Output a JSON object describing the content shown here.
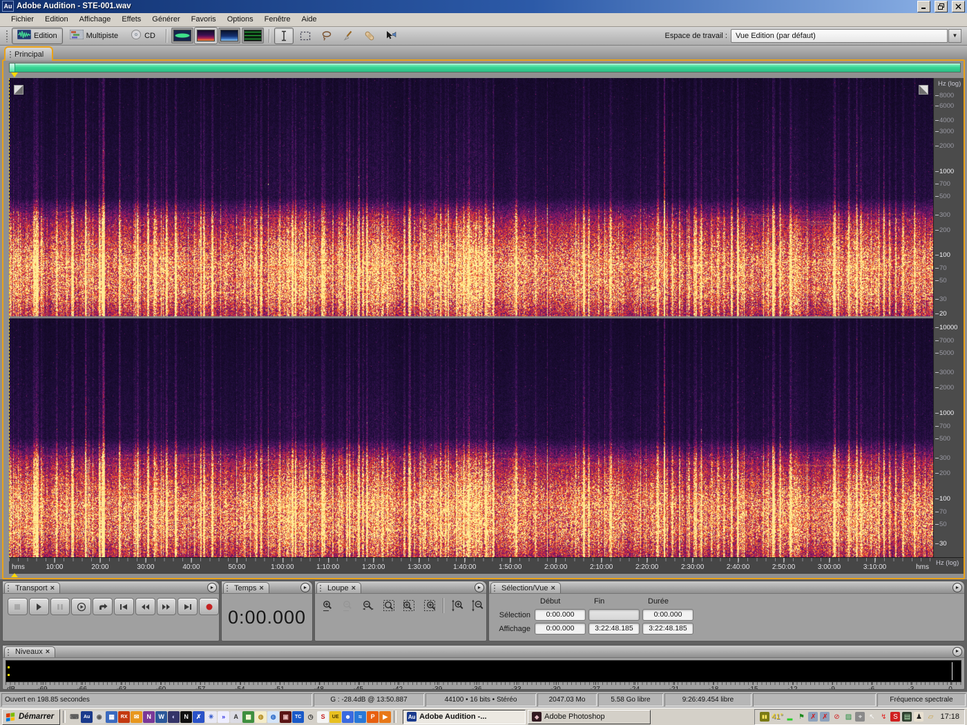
{
  "window": {
    "title": "Adobe Audition - STE-001.wav",
    "app_badge": "Au"
  },
  "icons": {
    "close": "×",
    "panel_menu": "►",
    "dropdown": "▼"
  },
  "menu": {
    "items": [
      "Fichier",
      "Edition",
      "Affichage",
      "Effets",
      "Générer",
      "Favoris",
      "Options",
      "Fenêtre",
      "Aide"
    ]
  },
  "toolbar": {
    "modes": [
      {
        "id": "edition",
        "label": "Edition",
        "active": true
      },
      {
        "id": "multipiste",
        "label": "Multipiste",
        "active": false
      },
      {
        "id": "cd",
        "label": "CD",
        "active": false
      }
    ],
    "views": [
      {
        "id": "waveform-view",
        "active": false
      },
      {
        "id": "spectral-frequency-view",
        "active": true
      },
      {
        "id": "spectral-pan-view",
        "active": false
      },
      {
        "id": "spectral-phase-view",
        "active": false
      }
    ],
    "tools": [
      {
        "id": "time-selection-tool",
        "active": true
      },
      {
        "id": "marquee-selection-tool",
        "active": false
      },
      {
        "id": "lasso-selection-tool",
        "active": false
      },
      {
        "id": "effects-paintbrush-tool",
        "active": false
      },
      {
        "id": "spot-healing-brush-tool",
        "active": false
      },
      {
        "id": "scrub-tool",
        "active": false
      }
    ],
    "workspace": {
      "label": "Espace de travail :",
      "value": "Vue Edition (par défaut)"
    }
  },
  "tabs": {
    "main": "Principal"
  },
  "spectral_view": {
    "unit_label": "Hz (log)",
    "palette": {
      "background": "#140a28",
      "mid": "#8a1858",
      "hot": "#f09040",
      "peak": "#ffec96"
    },
    "channels": [
      {
        "name": "left",
        "fmin": 19,
        "fmax": 13000,
        "labels": [
          {
            "f": 8000
          },
          {
            "f": 6000
          },
          {
            "f": 4000
          },
          {
            "f": 3000
          },
          {
            "f": 2000
          },
          {
            "f": 1000,
            "major": true
          },
          {
            "f": 700
          },
          {
            "f": 500
          },
          {
            "f": 300
          },
          {
            "f": 200
          },
          {
            "f": 100,
            "major": true
          },
          {
            "f": 70
          },
          {
            "f": 50
          },
          {
            "f": 30
          },
          {
            "f": 20,
            "major": true
          }
        ]
      },
      {
        "name": "right",
        "fmin": 21,
        "fmax": 13000,
        "labels": [
          {
            "f": 10000,
            "major": true
          },
          {
            "f": 7000
          },
          {
            "f": 5000
          },
          {
            "f": 3000
          },
          {
            "f": 2000
          },
          {
            "f": 1000,
            "major": true
          },
          {
            "f": 700
          },
          {
            "f": 500
          },
          {
            "f": 300
          },
          {
            "f": 200
          },
          {
            "f": 100,
            "major": true
          },
          {
            "f": 70
          },
          {
            "f": 50
          },
          {
            "f": 30,
            "major": true
          }
        ]
      }
    ]
  },
  "timeline": {
    "unit": "hms",
    "view_end_seconds": 12168.185,
    "labels": [
      "10:00",
      "20:00",
      "30:00",
      "40:00",
      "50:00",
      "1:00:00",
      "1:10:00",
      "1:20:00",
      "1:30:00",
      "1:40:00",
      "1:50:00",
      "2:00:00",
      "2:10:00",
      "2:20:00",
      "2:30:00",
      "2:40:00",
      "2:50:00",
      "3:00:00",
      "3:10:00"
    ]
  },
  "transport": {
    "title": "Transport",
    "buttons": [
      {
        "id": "stop",
        "disabled": true
      },
      {
        "id": "play",
        "disabled": false
      },
      {
        "id": "pause",
        "disabled": true
      },
      {
        "id": "play-from-cursor",
        "disabled": false
      },
      {
        "id": "play-looped",
        "disabled": false
      },
      {
        "id": "go-to-start",
        "disabled": false
      },
      {
        "id": "rewind",
        "disabled": false
      },
      {
        "id": "fast-forward",
        "disabled": false
      },
      {
        "id": "go-to-end",
        "disabled": false
      },
      {
        "id": "record",
        "disabled": false
      }
    ]
  },
  "temps": {
    "title": "Temps",
    "value": "0:00.000"
  },
  "loupe": {
    "title": "Loupe",
    "buttons": [
      {
        "id": "zoom-in-horizontal",
        "disabled": false
      },
      {
        "id": "zoom-out-horizontal",
        "disabled": true
      },
      {
        "id": "zoom-out-full",
        "disabled": false
      },
      {
        "id": "zoom-to-selection",
        "disabled": false
      },
      {
        "id": "zoom-selection-left",
        "disabled": false
      },
      {
        "id": "zoom-selection-right",
        "disabled": false
      },
      {
        "id": "zoom-in-vertical",
        "disabled": false
      },
      {
        "id": "zoom-out-vertical",
        "disabled": false
      }
    ]
  },
  "selection_vue": {
    "title": "Sélection/Vue",
    "columns": [
      "Début",
      "Fin",
      "Durée"
    ],
    "rows": [
      {
        "label": "Sélection",
        "values": [
          "0:00.000",
          "",
          "0:00.000"
        ]
      },
      {
        "label": "Affichage",
        "values": [
          "0:00.000",
          "3:22:48.185",
          "3:22:48.185"
        ]
      }
    ]
  },
  "niveaux": {
    "title": "Niveaux",
    "unit": "dB",
    "db_min": -71.6,
    "labels": [
      "-69",
      "-66",
      "-63",
      "-60",
      "-57",
      "-54",
      "-51",
      "-48",
      "-45",
      "-42",
      "-39",
      "-36",
      "-33",
      "-30",
      "-27",
      "-24",
      "-21",
      "-18",
      "-15",
      "-12",
      "-9",
      "-6",
      "-3",
      "0"
    ]
  },
  "statusbar": {
    "sections": [
      "Ouvert en 198.85 secondes",
      "G : -28.4dB @ 13:50.887",
      "44100 • 16 bits • Stéréo",
      "2047.03 Mo",
      "5.58 Go libre",
      "9:26:49.454 libre",
      "",
      "Fréquence spectrale"
    ]
  },
  "taskbar": {
    "start_label": "Démarrer",
    "quick_launch": [
      {
        "name": "show-desktop",
        "glyph": "⌨",
        "bg": "",
        "fg": "#555555"
      },
      {
        "name": "audition-quicklaunch",
        "glyph": "Au",
        "bg": "#1a3a8c",
        "fg": "#ffffff"
      },
      {
        "name": "media-player",
        "glyph": "◉",
        "bg": "#d8d8d8",
        "fg": "#555555"
      },
      {
        "name": "calculator",
        "glyph": "▦",
        "bg": "#3a6ac0",
        "fg": "#ffffff"
      },
      {
        "name": "izotope-rx",
        "glyph": "RX",
        "bg": "#c43a10",
        "fg": "#ffffff"
      },
      {
        "name": "mail",
        "glyph": "✉",
        "bg": "#e8971e",
        "fg": "#ffffff"
      },
      {
        "name": "onenote",
        "glyph": "N",
        "bg": "#7a3898",
        "fg": "#ffffff"
      },
      {
        "name": "word",
        "glyph": "W",
        "bg": "#2b579a",
        "fg": "#ffffff"
      },
      {
        "name": "netscape",
        "glyph": "◐",
        "bg": "#343468",
        "fg": "#cfcfff"
      },
      {
        "name": "navigator",
        "glyph": "N",
        "bg": "#101010",
        "fg": "#f0f0f0"
      },
      {
        "name": "photoshop-tool",
        "glyph": "✗",
        "bg": "#2a52c8",
        "fg": "#ffffff"
      },
      {
        "name": "star-tool",
        "glyph": "✳",
        "bg": "#e8e8f4",
        "fg": "#2a52c8"
      },
      {
        "name": "snipping-tool",
        "glyph": "»",
        "bg": "#eeeeff",
        "fg": "#2a2ae0"
      },
      {
        "name": "acrobat",
        "glyph": "A",
        "bg": "#dcdce4",
        "fg": "#333333"
      },
      {
        "name": "builder-tool",
        "glyph": "▩",
        "bg": "#3f8f3f",
        "fg": "#ffffdd"
      },
      {
        "name": "globe-gold",
        "glyph": "◍",
        "bg": "#f4ecc8",
        "fg": "#b08818"
      },
      {
        "name": "globe-blue",
        "glyph": "◍",
        "bg": "#d4e4f8",
        "fg": "#2868c8"
      },
      {
        "name": "tv-app",
        "glyph": "▣",
        "bg": "#5a1414",
        "fg": "#e8b8b8"
      },
      {
        "name": "total-commander",
        "glyph": "TC",
        "bg": "#1a5ac8",
        "fg": "#ffffff"
      },
      {
        "name": "clock-app",
        "glyph": "◷",
        "bg": "",
        "fg": "#333333"
      },
      {
        "name": "sound-blaster",
        "glyph": "S",
        "bg": "#f4f4f4",
        "fg": "#c42020"
      },
      {
        "name": "ultraedit",
        "glyph": "UE",
        "bg": "#e8c020",
        "fg": "#443300"
      },
      {
        "name": "messenger",
        "glyph": "☻",
        "bg": "#3a6ae0",
        "fg": "#ffffff"
      },
      {
        "name": "swoosh-app",
        "glyph": "≈",
        "bg": "#2878d8",
        "fg": "#ffffff"
      },
      {
        "name": "pdf-creator",
        "glyph": "P",
        "bg": "#e86010",
        "fg": "#ffffff"
      },
      {
        "name": "media-center",
        "glyph": "▶",
        "bg": "#e87818",
        "fg": "#ffffff"
      }
    ],
    "tasks": [
      {
        "label": "Adobe Audition -...",
        "badge": "Au",
        "badge_bg": "#1a3a8c",
        "badge_fg": "#ffffff",
        "active": true
      },
      {
        "label": "Adobe Photoshop",
        "badge": "◆",
        "badge_bg": "#301820",
        "badge_fg": "#e0b8c0",
        "active": false
      }
    ],
    "tray": {
      "temperature": "41°",
      "clock": "17:18",
      "icons": [
        {
          "name": "media-indicator",
          "glyph": "▮▮",
          "bg": "#7a7a14",
          "fg": "#ffe860"
        },
        {
          "name": "minimized-meter",
          "glyph": "▂",
          "bg": "",
          "fg": "#2ad02a"
        },
        {
          "name": "language-flag",
          "glyph": "⚑",
          "bg": "",
          "fg": "#1e8a1e"
        },
        {
          "name": "network-disabled-1",
          "glyph": "✗",
          "bg": "#8ea2bc",
          "fg": "#d01818"
        },
        {
          "name": "network-disabled-2",
          "glyph": "✗",
          "bg": "#8ea2bc",
          "fg": "#d01818"
        },
        {
          "name": "blocked-device",
          "glyph": "⊘",
          "bg": "",
          "fg": "#d01818"
        },
        {
          "name": "updater",
          "glyph": "▨",
          "bg": "",
          "fg": "#1e8a3a"
        },
        {
          "name": "mouse-settings",
          "glyph": "⌖",
          "bg": "#8a8a8a",
          "fg": "#f0f0f0"
        },
        {
          "name": "pointer-settings",
          "glyph": "↖",
          "bg": "",
          "fg": "#fafafa"
        },
        {
          "name": "sync-alert",
          "glyph": "↯",
          "bg": "",
          "fg": "#e02020"
        },
        {
          "name": "antivirus",
          "glyph": "S",
          "bg": "#d02020",
          "fg": "#ffffff"
        },
        {
          "name": "modem",
          "glyph": "▤",
          "bg": "#2e3e2e",
          "fg": "#b8e8b8"
        },
        {
          "name": "pet-app",
          "glyph": "♟",
          "bg": "#e8e0d0",
          "fg": "#222222"
        },
        {
          "name": "documents",
          "glyph": "▱",
          "bg": "",
          "fg": "#c8a040"
        }
      ]
    }
  },
  "colors": {
    "frame_accent": "#eaa218",
    "overview_bar": "#38d694",
    "titlebar_left": "#10306e",
    "titlebar_right": "#8fb4e8",
    "record_red": "#c42222",
    "meter_background": "#000000"
  }
}
